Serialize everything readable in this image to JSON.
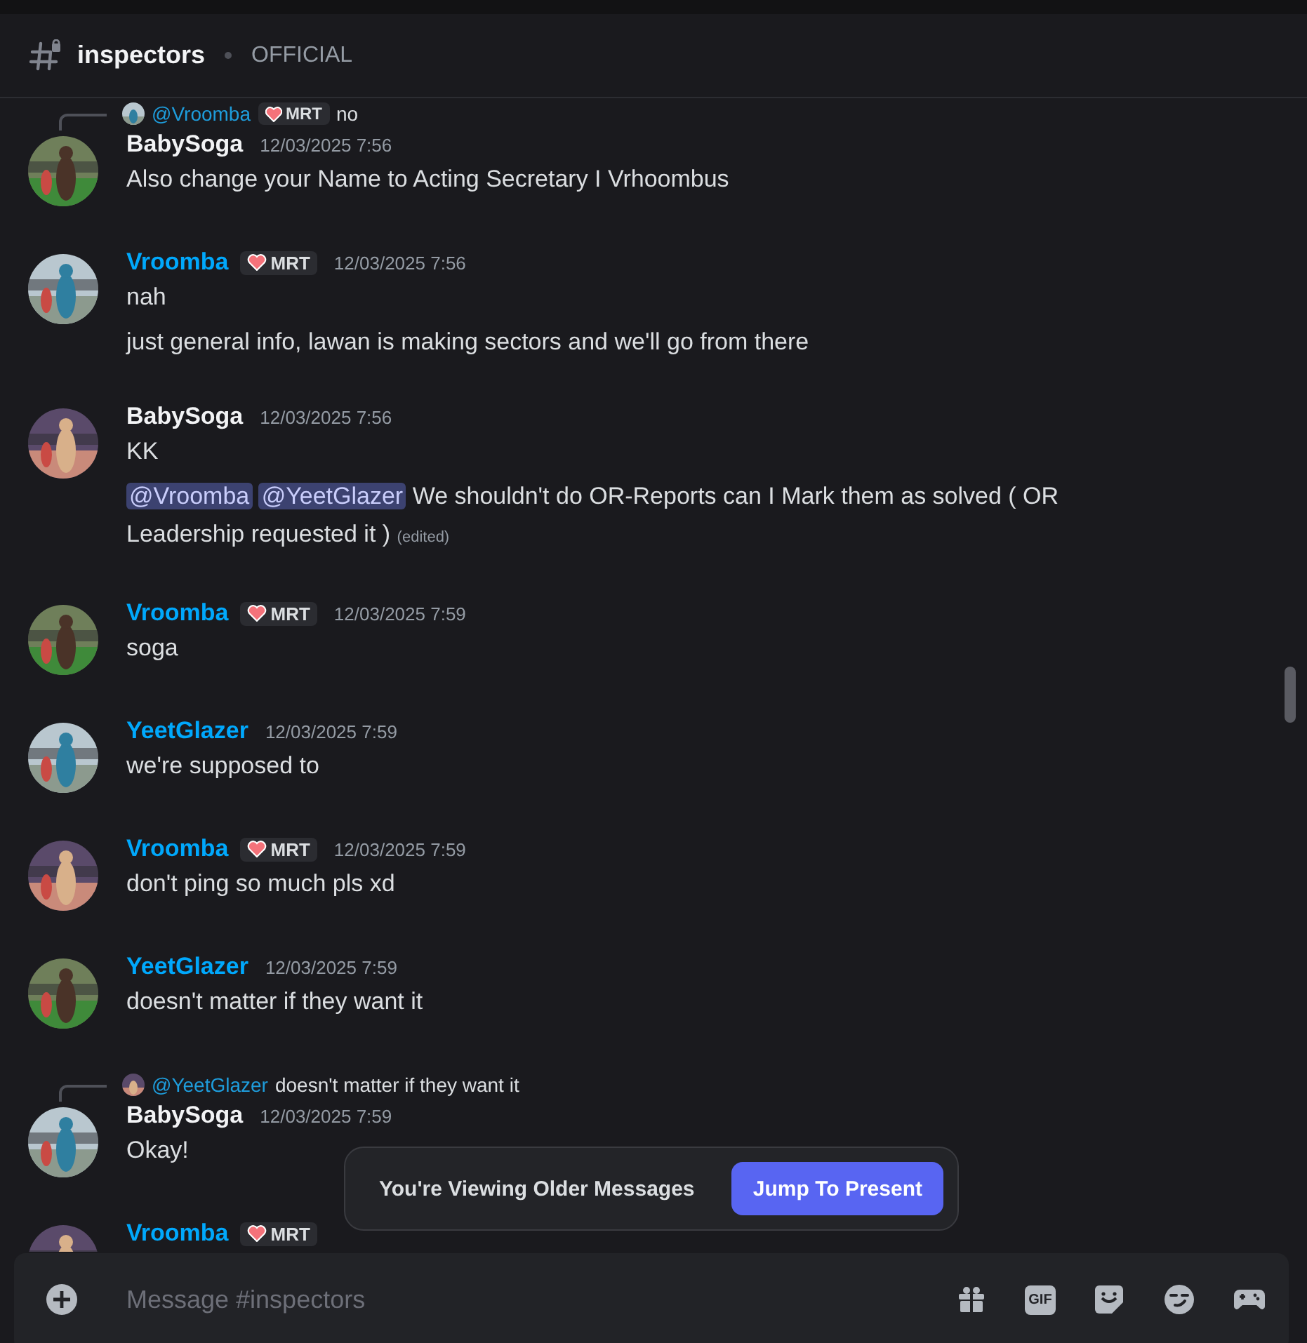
{
  "channel": {
    "name": "inspectors",
    "topic": "OFFICIAL"
  },
  "messages": [
    {
      "author": "BabySoga",
      "color": "#f2f3f5",
      "timestamp": "12/03/2025 7:56",
      "reply": {
        "mention": "@Vroomba",
        "badge": "MRT",
        "text": "no"
      },
      "paragraphs": [
        {
          "parts": [
            {
              "kind": "text",
              "text": "Also change your Name to Acting Secretary I Vrhoombus"
            }
          ]
        }
      ]
    },
    {
      "author": "Vroomba",
      "color": "#00a8fc",
      "badge": "MRT",
      "timestamp": "12/03/2025 7:56",
      "paragraphs": [
        {
          "parts": [
            {
              "kind": "text",
              "text": "nah"
            }
          ]
        },
        {
          "parts": [
            {
              "kind": "text",
              "text": "just general info, lawan is making sectors and we'll go from there"
            }
          ]
        }
      ]
    },
    {
      "author": "BabySoga",
      "color": "#f2f3f5",
      "timestamp": "12/03/2025 7:56",
      "paragraphs": [
        {
          "parts": [
            {
              "kind": "text",
              "text": "KK"
            }
          ]
        },
        {
          "parts": [
            {
              "kind": "mention",
              "text": "@Vroomba"
            },
            {
              "kind": "mention",
              "text": "@YeetGlazer"
            },
            {
              "kind": "text",
              "text": "We shouldn't do OR-Reports can I Mark them as solved ( OR Leadership requested it )"
            }
          ],
          "edited": "(edited)"
        }
      ]
    },
    {
      "author": "Vroomba",
      "color": "#00a8fc",
      "badge": "MRT",
      "timestamp": "12/03/2025 7:59",
      "paragraphs": [
        {
          "parts": [
            {
              "kind": "text",
              "text": "soga"
            }
          ]
        }
      ]
    },
    {
      "author": "YeetGlazer",
      "color": "#00a8fc",
      "timestamp": "12/03/2025 7:59",
      "paragraphs": [
        {
          "parts": [
            {
              "kind": "text",
              "text": "we're supposed to"
            }
          ]
        }
      ]
    },
    {
      "author": "Vroomba",
      "color": "#00a8fc",
      "badge": "MRT",
      "timestamp": "12/03/2025 7:59",
      "paragraphs": [
        {
          "parts": [
            {
              "kind": "text",
              "text": "don't ping so much pls xd"
            }
          ]
        }
      ]
    },
    {
      "author": "YeetGlazer",
      "color": "#00a8fc",
      "timestamp": "12/03/2025 7:59",
      "paragraphs": [
        {
          "parts": [
            {
              "kind": "text",
              "text": "doesn't matter if they want it"
            }
          ]
        }
      ]
    },
    {
      "author": "BabySoga",
      "color": "#f2f3f5",
      "timestamp": "12/03/2025 7:59",
      "reply": {
        "mention": "@YeetGlazer",
        "text": "doesn't matter if they want it"
      },
      "paragraphs": [
        {
          "parts": [
            {
              "kind": "text",
              "text": "Okay!"
            }
          ]
        }
      ]
    },
    {
      "author": "Vroomba",
      "color": "#00a8fc",
      "badge": "MRT"
    }
  ],
  "notice": {
    "text": "You're Viewing Older Messages",
    "button": "Jump To Present"
  },
  "composer": {
    "placeholder": "Message #inspectors",
    "gif_label": "GIF"
  }
}
